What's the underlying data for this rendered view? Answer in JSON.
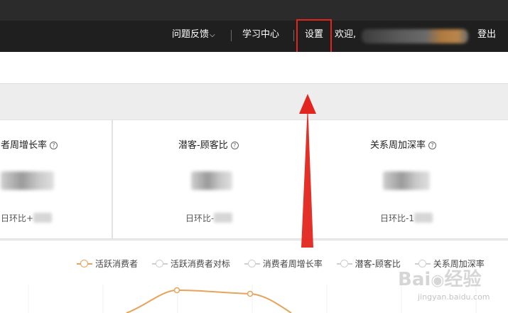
{
  "header": {
    "feedback_label": "问题反馈",
    "learning_label": "学习中心",
    "settings_label": "设置",
    "welcome_label": "欢迎,",
    "logout_label": "登出"
  },
  "cards": [
    {
      "title": "者周增长率",
      "sub_label": "日环比+"
    },
    {
      "title": "潜客-顾客比",
      "sub_label": "日环比-"
    },
    {
      "title": "关系周加深率",
      "sub_label": "日环比-1"
    }
  ],
  "legend": [
    {
      "label": "活跃消费者",
      "color": "#e8a35a",
      "active": true
    },
    {
      "label": "活跃消费者对标",
      "color": "#cfcfcf",
      "active": false
    },
    {
      "label": "消费者周增长率",
      "color": "#cfcfcf",
      "active": false
    },
    {
      "label": "潜客-顾客比",
      "color": "#cfcfcf",
      "active": false
    },
    {
      "label": "关系周加深率",
      "color": "#cfcfcf",
      "active": false
    }
  ],
  "colors": {
    "accent_line": "#e8a35a",
    "annotation_red": "#e2261f"
  },
  "watermark": {
    "text": "Bai du 经验",
    "url": "jingyan.baidu.com"
  }
}
